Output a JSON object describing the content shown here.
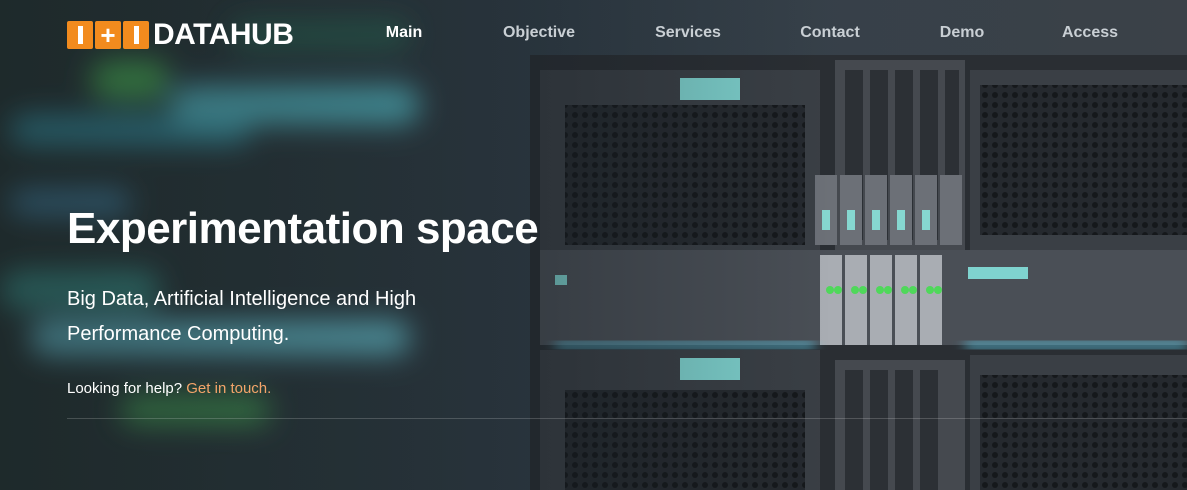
{
  "brand": {
    "logo_text": "DATAHUB",
    "logo_mark": [
      "bar",
      "plus",
      "bar"
    ],
    "accent_color": "#f28b1e"
  },
  "nav": {
    "items": [
      {
        "label": "Main",
        "active": true
      },
      {
        "label": "Objective",
        "active": false
      },
      {
        "label": "Services",
        "active": false
      },
      {
        "label": "Contact",
        "active": false
      },
      {
        "label": "Demo",
        "active": false
      },
      {
        "label": "Access",
        "active": false
      }
    ]
  },
  "hero": {
    "title": "Experimentation space",
    "subtitle": "Big Data, Artificial Intelligence and High Performance Computing.",
    "help_prefix": "Looking for help?",
    "help_link": "Get in touch.",
    "link_color": "#f4a46a",
    "background": "server-rack-photo"
  }
}
